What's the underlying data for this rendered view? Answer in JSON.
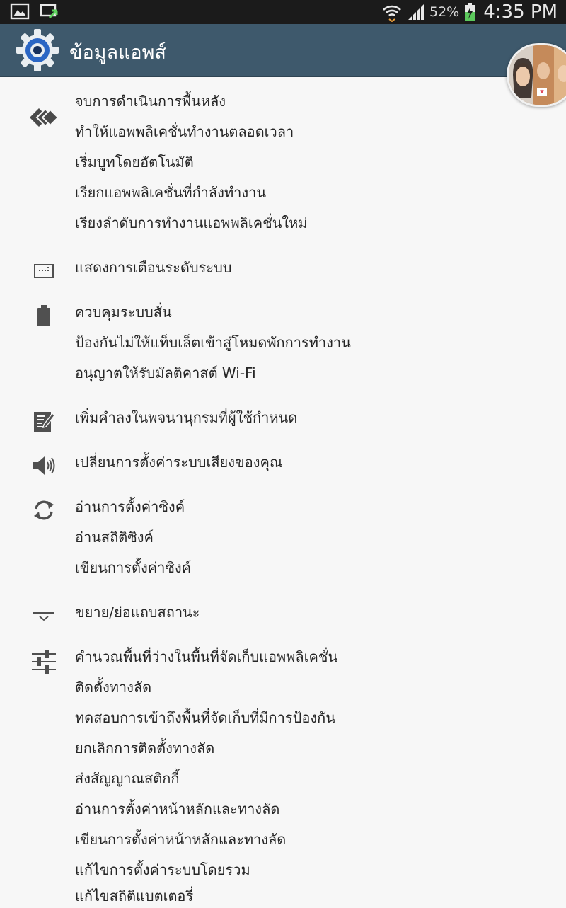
{
  "status_bar": {
    "battery_percent": "52%",
    "time": "4:35 PM",
    "icons": [
      "gallery-notification-icon",
      "sync-notification-icon",
      "wifi-icon",
      "signal-icon",
      "battery-charging-icon"
    ]
  },
  "app_bar": {
    "title": "ข้อมูลแอพส์",
    "icon": "settings-gear-icon"
  },
  "colors": {
    "status_bar": "#1b1b1b",
    "app_bar": "#3e596c",
    "background": "#f7f7f7",
    "text": "#262626",
    "icon": "#505050",
    "divider": "#b9b9b9"
  },
  "permission_groups": [
    {
      "icon": "app-tasks-icon",
      "items": [
        "จบการดำเนินการพื้นหลัง",
        "ทำให้แอพพลิเคชั่นทำงานตลอดเวลา",
        "เริ่มบูทโดยอัตโนมัติ",
        "เรียกแอพพลิเคชั่นที่กำลังทำงาน",
        "เรียงลำดับการทำงานแอพพลิเคชั่นใหม่"
      ]
    },
    {
      "icon": "system-alert-window-icon",
      "items": [
        "แสดงการเตือนระดับระบบ"
      ]
    },
    {
      "icon": "battery-icon",
      "items": [
        "ควบคุมระบบสั่น",
        "ป้องกันไม่ให้แท็บเล็ตเข้าสู่โหมดพักการทำงาน",
        "อนุญาตให้รับมัลติคาสต์ Wi-Fi"
      ]
    },
    {
      "icon": "dictionary-edit-icon",
      "items": [
        "เพิ่มคำลงในพจนานุกรมที่ผู้ใช้กำหนด"
      ]
    },
    {
      "icon": "audio-settings-icon",
      "items": [
        "เปลี่ยนการตั้งค่าระบบเสียงของคุณ"
      ]
    },
    {
      "icon": "sync-settings-icon",
      "items": [
        "อ่านการตั้งค่าซิงค์",
        "อ่านสถิติซิงค์",
        "เขียนการตั้งค่าซิงค์"
      ]
    },
    {
      "icon": "status-bar-expand-icon",
      "items": [
        "ขยาย/ย่อแถบสถานะ"
      ]
    },
    {
      "icon": "system-tools-icon",
      "items": [
        "คำนวณพื้นที่ว่างในพื้นที่จัดเก็บแอพพลิเคชั่น",
        "ติดตั้งทางลัด",
        "ทดสอบการเข้าถึงพื้นที่จัดเก็บที่มีการป้องกัน",
        "ยกเลิกการติดตั้งทางลัด",
        "ส่งสัญญาณสติกกี้",
        "อ่านการตั้งค่าหน้าหลักและทางลัด",
        "เขียนการตั้งค่าหน้าหลักและทางลัด",
        "แก้ไขการตั้งค่าระบบโดยรวม",
        "แก้ไขสถิติแบตเตอรี่"
      ]
    }
  ]
}
